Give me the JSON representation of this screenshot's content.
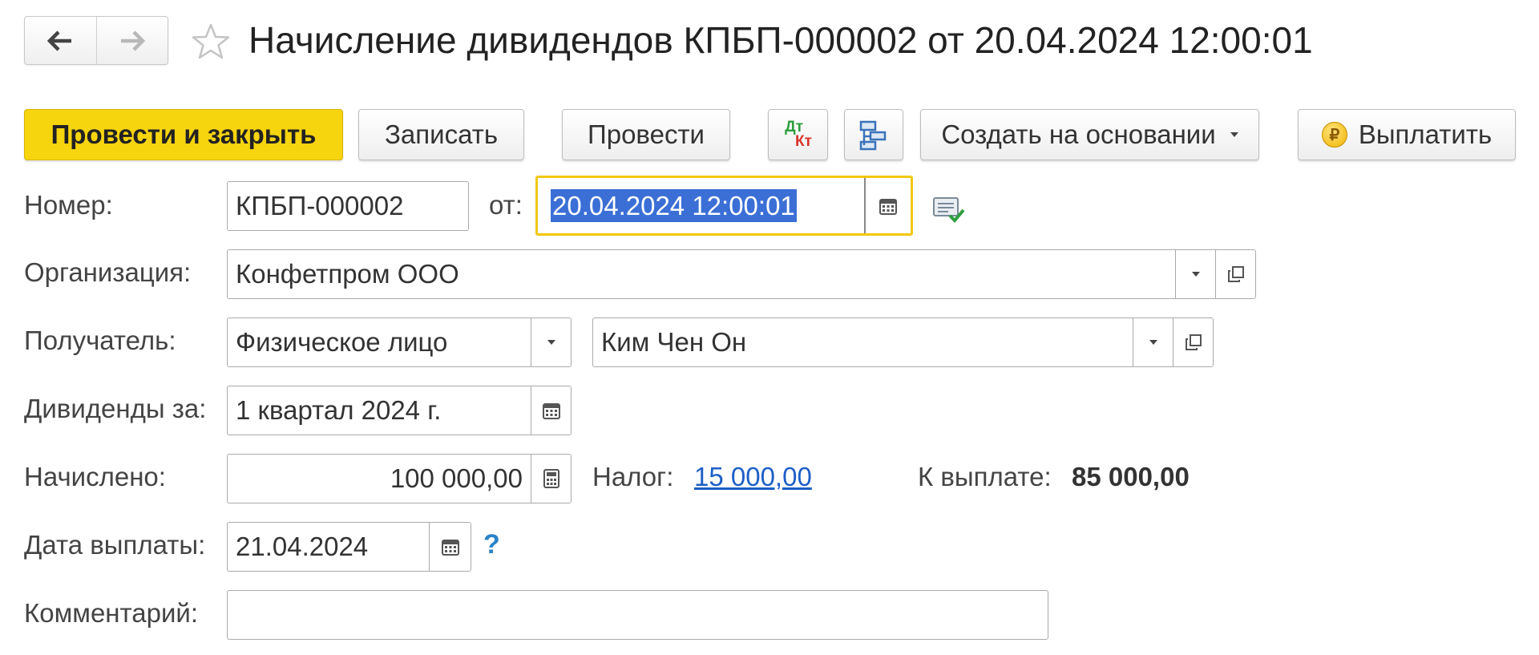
{
  "window": {
    "title": "Начисление дивидендов КПБП-000002 от 20.04.2024 12:00:01"
  },
  "toolbar": {
    "post_and_close": "Провести и закрыть",
    "save": "Записать",
    "post": "Провести",
    "dt_label": "Дт",
    "kt_label": "Кт",
    "create_based_on": "Создать на основании",
    "pay": "Выплатить",
    "pay_coin_symbol": "₽"
  },
  "form": {
    "number": {
      "label": "Номер:",
      "value": "КПБП-000002"
    },
    "date": {
      "label": "от:",
      "value": "20.04.2024 12:00:01"
    },
    "organization": {
      "label": "Организация:",
      "value": "Конфетпром ООО"
    },
    "recipient": {
      "label": "Получатель:",
      "type_value": "Физическое лицо",
      "person_value": "Ким Чен Он"
    },
    "dividends_for": {
      "label": "Дивиденды за:",
      "value": "1 квартал 2024 г."
    },
    "accrued": {
      "label": "Начислено:",
      "value": "100 000,00"
    },
    "tax": {
      "label": "Налог:",
      "value": "15 000,00"
    },
    "to_pay": {
      "label": "К выплате:",
      "value": "85 000,00"
    },
    "payment_date": {
      "label": "Дата выплаты:",
      "value": "21.04.2024",
      "help": "?"
    },
    "comment": {
      "label": "Комментарий:",
      "value": ""
    }
  },
  "colors": {
    "primary_button": "#f6d40e",
    "focus_border": "#f2c811",
    "selection": "#3b6fd6",
    "link": "#1d5fc6",
    "dt_green": "#2e9e3e",
    "kt_red": "#d9342b"
  },
  "icons": {
    "back": "arrow-left-icon",
    "forward": "arrow-right-icon",
    "favorite": "star-icon",
    "calendar": "calendar-icon",
    "calculator": "calculator-icon",
    "dropdown": "chevron-down-icon",
    "open": "open-form-icon",
    "structure": "document-structure-icon",
    "postings": "dt-kt-icon",
    "coin": "ruble-coin-icon",
    "check_doc": "checked-document-icon"
  }
}
